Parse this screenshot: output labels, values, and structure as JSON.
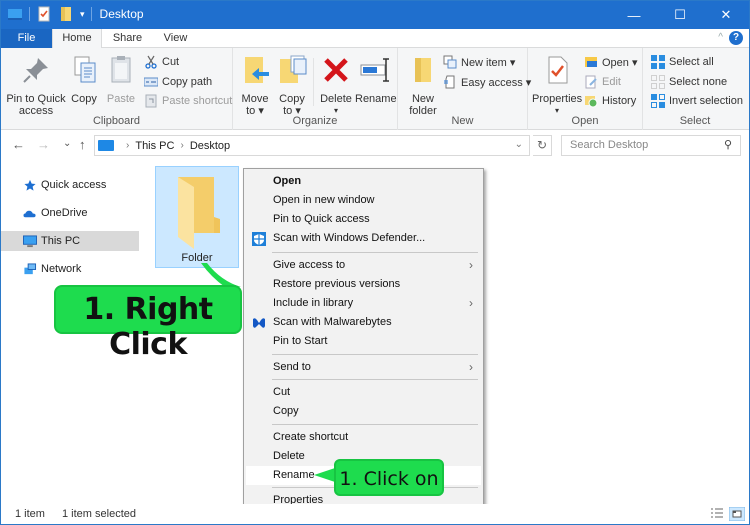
{
  "window": {
    "title": "Desktop",
    "controls": {
      "minimize": "—",
      "maximize": "☐",
      "close": "✕"
    }
  },
  "tabs": [
    {
      "label": "File"
    },
    {
      "label": "Home"
    },
    {
      "label": "Share"
    },
    {
      "label": "View"
    }
  ],
  "ribbon": {
    "clipboard": {
      "label": "Clipboard",
      "pin_label_1": "Pin to Quick",
      "pin_label_2": "access",
      "copy": "Copy",
      "paste": "Paste",
      "cut": "Cut",
      "copy_path": "Copy path",
      "paste_shortcut": "Paste shortcut"
    },
    "organize": {
      "label": "Organize",
      "move_1": "Move",
      "move_2": "to ▾",
      "copy_1": "Copy",
      "copy_2": "to ▾",
      "delete": "Delete",
      "delete_arrow": "▾",
      "rename": "Rename"
    },
    "new": {
      "label": "New",
      "new_folder_1": "New",
      "new_folder_2": "folder",
      "new_item": "New item ▾",
      "easy_access": "Easy access ▾"
    },
    "open": {
      "label": "Open",
      "properties": "Properties",
      "properties_arrow": "▾",
      "open": "Open ▾",
      "edit": "Edit",
      "history": "History"
    },
    "select": {
      "label": "Select",
      "select_all": "Select all",
      "select_none": "Select none",
      "invert_selection": "Invert selection"
    },
    "collapse_glyph": "^",
    "help_glyph": "?"
  },
  "nav": {
    "back": "←",
    "forward": "→",
    "recent": "⌄",
    "up": "↑",
    "breadcrumb": [
      "This PC",
      "Desktop"
    ],
    "crumb_sep": "›",
    "dropdown": "⌄",
    "refresh": "↻",
    "search_placeholder": "Search Desktop",
    "search_icon": "⚲"
  },
  "navpane": {
    "items": [
      {
        "label": "Quick access",
        "icon": "star-icon"
      },
      {
        "label": "OneDrive",
        "icon": "cloud-icon"
      },
      {
        "label": "This PC",
        "icon": "computer-icon",
        "selected": true
      },
      {
        "label": "Network",
        "icon": "network-icon"
      }
    ]
  },
  "content": {
    "items": [
      {
        "name": "Folder",
        "selected": true
      }
    ]
  },
  "context_menu": {
    "items": [
      {
        "label": "Open",
        "bold": true
      },
      {
        "label": "Open in new window"
      },
      {
        "label": "Pin to Quick access"
      },
      {
        "label": "Scan with Windows Defender...",
        "icon": "windows-defender-icon"
      },
      {
        "label": "Give access to",
        "submenu": true
      },
      {
        "label": "Restore previous versions"
      },
      {
        "label": "Include in library",
        "submenu": true
      },
      {
        "label": "Scan with Malwarebytes",
        "icon": "malwarebytes-icon"
      },
      {
        "label": "Pin to Start"
      },
      {
        "label": "Send to",
        "submenu": true
      },
      {
        "label": "Cut"
      },
      {
        "label": "Copy"
      },
      {
        "label": "Create shortcut"
      },
      {
        "label": "Delete"
      },
      {
        "label": "Rename",
        "highlighted": true
      },
      {
        "label": "Properties"
      }
    ],
    "submenu_arrow": "›"
  },
  "callouts": {
    "right_click": "1. Right Click",
    "click_on": "1. Click on",
    "color": "#1edc4e"
  },
  "statusbar": {
    "item_count": "1 item",
    "selection": "1 item selected"
  },
  "colors": {
    "titlebar": "#1f6fce",
    "file_tab": "#1a66c2",
    "selection": "#cce8ff"
  }
}
